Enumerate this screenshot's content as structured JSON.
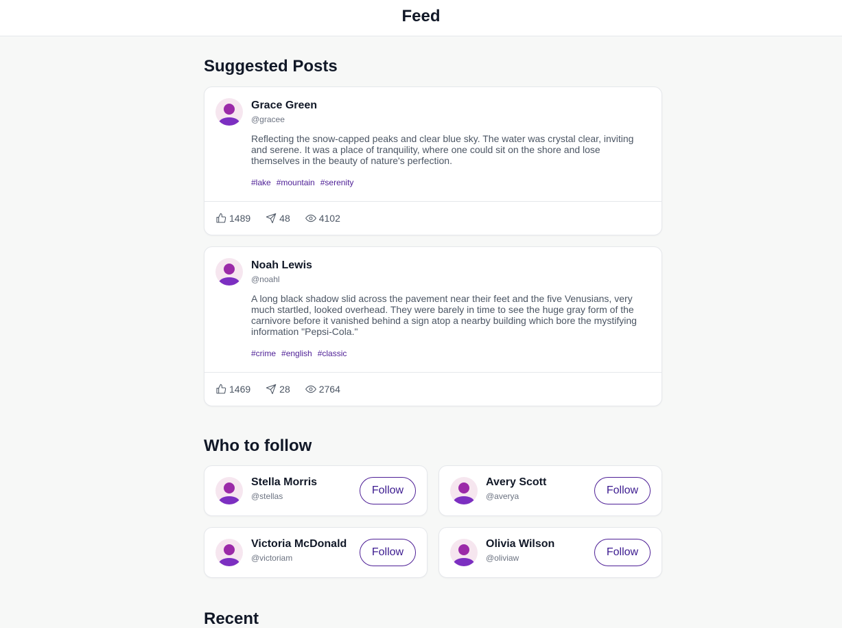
{
  "header": {
    "title": "Feed"
  },
  "suggested": {
    "title": "Suggested Posts",
    "posts": [
      {
        "name": "Grace Green",
        "handle": "@gracee",
        "text": "Reflecting the snow-capped peaks and clear blue sky. The water was crystal clear, inviting and serene. It was a place of tranquility, where one could sit on the shore and lose themselves in the beauty of nature's perfection.",
        "tags": [
          "#lake",
          "#mountain",
          "#serenity"
        ],
        "likes": "1489",
        "shares": "48",
        "views": "4102"
      },
      {
        "name": "Noah Lewis",
        "handle": "@noahl",
        "text": "A long black shadow slid across the pavement near their feet and the five Venusians, very much startled, looked overhead. They were barely in time to see the huge gray form of the carnivore before it vanished behind a sign atop a nearby building which bore the mystifying information \"Pepsi-Cola.\"",
        "tags": [
          "#crime",
          "#english",
          "#classic"
        ],
        "likes": "1469",
        "shares": "28",
        "views": "2764"
      }
    ]
  },
  "who_to_follow": {
    "title": "Who to follow",
    "button_label": "Follow",
    "users": [
      {
        "name": "Stella Morris",
        "handle": "@stellas"
      },
      {
        "name": "Avery Scott",
        "handle": "@averya"
      },
      {
        "name": "Victoria McDonald",
        "handle": "@victoriam"
      },
      {
        "name": "Olivia Wilson",
        "handle": "@oliviaw"
      }
    ]
  },
  "recent": {
    "title": "Recent"
  },
  "icons": {
    "like": "thumbs-up-icon",
    "share": "send-icon",
    "views": "eye-icon",
    "avatar": "user-avatar-icon"
  },
  "colors": {
    "accent": "#4c1d95",
    "avatar_bg": "#f6e6ef",
    "avatar_head": "#9b2aa8",
    "avatar_body": "#7c2fc1"
  }
}
